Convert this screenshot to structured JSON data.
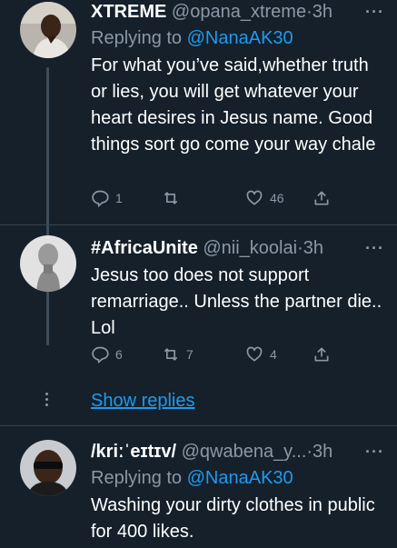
{
  "tweets": [
    {
      "name": "XTREME",
      "handle": "@opana_xtreme",
      "separator": "·",
      "time": "3h",
      "more": "···",
      "replying_prefix": "Replying to",
      "replying_to": "@NanaAK30",
      "body": "For what you’ve said,whether truth or lies, you will get whatever your heart desires in Jesus name. Good things sort go come your way chale",
      "replies": "1",
      "retweets": "",
      "likes": "46"
    },
    {
      "name": "#AfricaUnite",
      "handle": "@nii_koolai",
      "separator": "·",
      "time": "3h",
      "more": "···",
      "body": "Jesus too does not support remarriage.. Unless the partner die.. Lol",
      "replies": "6",
      "retweets": "7",
      "likes": "4"
    },
    {
      "name": "/kriːˈeɪtɪv/",
      "handle": "@qwabena_y...",
      "separator": "·",
      "time": "3h",
      "more": "···",
      "replying_prefix": "Replying to",
      "replying_to": "@NanaAK30",
      "body": "Washing your dirty clothes in public for 400 likes."
    }
  ],
  "show_replies": "Show replies",
  "colors": {
    "background": "#15202b",
    "accent": "#1d9bf0",
    "muted": "#8b98a5",
    "divider": "#38444d"
  },
  "icons": [
    "reply-icon",
    "retweet-icon",
    "like-icon",
    "share-icon",
    "more-icon"
  ]
}
